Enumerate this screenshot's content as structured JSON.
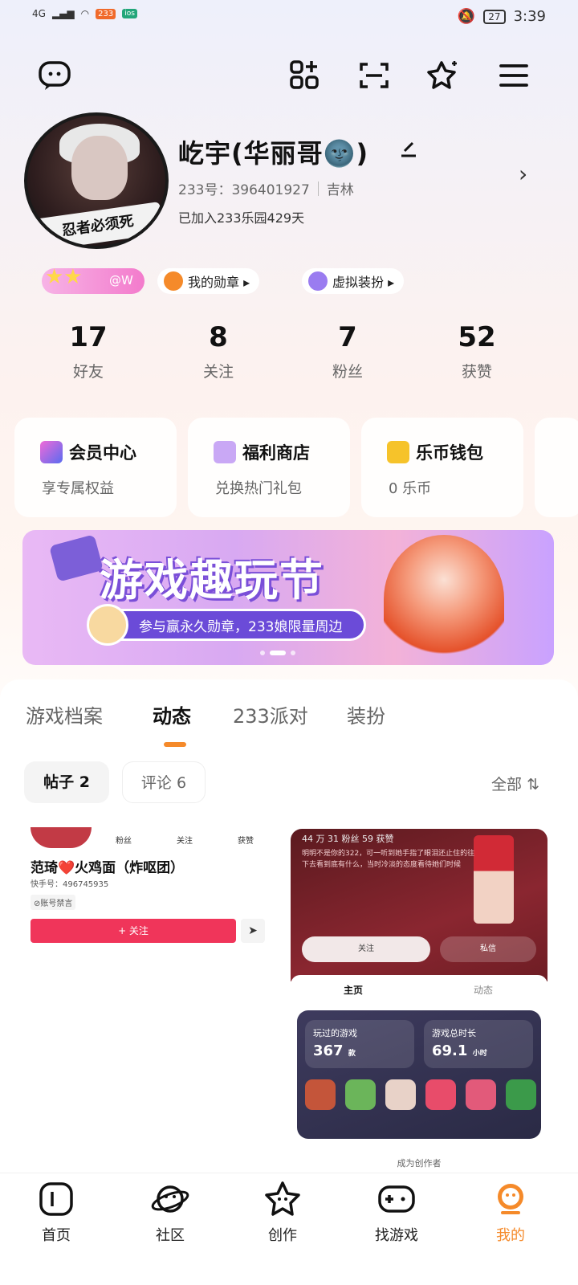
{
  "status_bar": {
    "signal_label": "4G",
    "badge1": "233",
    "badge2": "ios",
    "battery": "27",
    "time": "3:39"
  },
  "top_bar": {
    "icons": [
      "message-icon",
      "grid-add-icon",
      "scan-icon",
      "star-sparkle-icon",
      "menu-icon"
    ]
  },
  "profile": {
    "name": "屹宇(华丽哥🌚)",
    "id_label": "233号：396401927",
    "location": "吉林",
    "joined": "已加入233乐园429天",
    "avatar_banner_text": "忍者必须死"
  },
  "badges": {
    "w_label": "@W",
    "medal_label": "我的勋章 ▸",
    "outfit_label": "虚拟装扮 ▸"
  },
  "stats": [
    {
      "num": "17",
      "label": "好友"
    },
    {
      "num": "8",
      "label": "关注"
    },
    {
      "num": "7",
      "label": "粉丝"
    },
    {
      "num": "52",
      "label": "获赞"
    }
  ],
  "cards": [
    {
      "title": "会员中心",
      "sub": "享专属权益",
      "color": "#7a4df0"
    },
    {
      "title": "福利商店",
      "sub": "兑换热门礼包",
      "color": "#b892f0"
    },
    {
      "title": "乐币钱包",
      "sub": "0 乐币",
      "color": "#f6c32a"
    }
  ],
  "banner": {
    "title": "游戏趣玩节",
    "subtitle": "参与赢永久勋章，233娘限量周边"
  },
  "tabs": [
    "游戏档案",
    "动态",
    "233派对",
    "装扮"
  ],
  "chips": {
    "posts": "帖子 2",
    "comments": "评论 6",
    "filter": "全部 ⇅"
  },
  "post1": {
    "stats": [
      "粉丝",
      "关注",
      "获赞"
    ],
    "name": "范琦❤️火鸡面（炸呕团）",
    "id": "快手号：496745935",
    "warn": "⊘账号禁言",
    "follow": "+ 关注",
    "send": "➤"
  },
  "post2": {
    "stats": "44 万 31 粉丝 59 获赞",
    "desc": "明明不是你的322，可一听到她手指了眼泪还止住的往下去看到底有什么，当时冷淡的态度看待她们时候",
    "follow": "关注",
    "message": "私信",
    "tab_home": "主页",
    "tab_feed": "动态",
    "played_label": "玩过的游戏",
    "played_value": "367",
    "played_unit": "款",
    "time_label": "游戏总时长",
    "time_value": "69.1",
    "time_unit": "小时",
    "footer": "成为创作者"
  },
  "nav": [
    {
      "label": "首页",
      "icon": "home-icon"
    },
    {
      "label": "社区",
      "icon": "planet-icon"
    },
    {
      "label": "创作",
      "icon": "star-icon"
    },
    {
      "label": "找游戏",
      "icon": "gamepad-icon"
    },
    {
      "label": "我的",
      "icon": "profile-icon"
    }
  ]
}
